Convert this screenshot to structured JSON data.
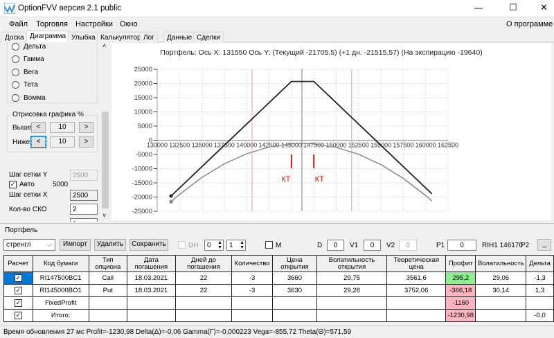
{
  "window": {
    "title": "OptionFVV версия 2.1 public",
    "minimize": "—",
    "maximize": "☐",
    "close": "✕"
  },
  "menu": {
    "items": [
      "Файл",
      "Торговля",
      "Настройки",
      "Окно"
    ],
    "about": "О программе"
  },
  "tabs": [
    "Доска",
    "Диаграмма",
    "Улыбка",
    "Калькулятор",
    "Лог",
    "Данные",
    "Сделки"
  ],
  "left": {
    "radios": [
      "Дельта",
      "Гамма",
      "Вега",
      "Тета",
      "Вомма"
    ],
    "draw_group": "Отрисовка графика %",
    "above_label": "Выше",
    "above_value": "10",
    "below_label": "Ниже",
    "below_value": "10",
    "prev": "<",
    "next": ">",
    "grid_y_label": "Шаг сетки Y",
    "grid_y_value": "2500",
    "auto_label": "Авто",
    "auto_value": "5000",
    "grid_x_label": "Шаг сетки X",
    "grid_x_value": "2500",
    "sko_label": "Кол-во СКО",
    "sko_value": "2",
    "next_value": "1"
  },
  "chart_data": {
    "type": "line",
    "title": "Портфель: Ось X:  131550 Ось Y:  (Текущий  -21705,5)  (+1 дн.  -21515,57)  (На экспирацию  -19640)",
    "xlim": [
      130000,
      162500
    ],
    "ylim": [
      -25000,
      25000
    ],
    "xticks": [
      130000,
      132500,
      135000,
      137500,
      140000,
      142500,
      145000,
      147500,
      150000,
      152500,
      155000,
      157500,
      160000,
      162500
    ],
    "yticks": [
      25000,
      20000,
      15000,
      10000,
      5000,
      0,
      -5000,
      -10000,
      -15000,
      -20000,
      -25000
    ],
    "grid": true,
    "x": [
      131550,
      132500,
      135000,
      137500,
      140000,
      142500,
      145000,
      146170,
      147500,
      150000,
      152500,
      155000,
      157500,
      160000,
      160700
    ],
    "series": [
      {
        "name": "На экспирацию",
        "color": "#222222",
        "values": [
          -19640,
          -16790,
          -9290,
          -1790,
          5710,
          13210,
          20710,
          20710,
          20710,
          13210,
          5710,
          -1790,
          -9290,
          -16790,
          -18890
        ]
      },
      {
        "name": "+1 дн.",
        "color": "#aaaaaa",
        "values": [
          -21516,
          -18950,
          -12990,
          -8240,
          -4700,
          -2350,
          -1200,
          -1080,
          -1240,
          -2470,
          -4890,
          -8510,
          -13330,
          -19360,
          -21270
        ]
      },
      {
        "name": "Текущий",
        "color": "#888888",
        "values": [
          -21705,
          -19114,
          -13128,
          -8346,
          -4770,
          -2398,
          -1232,
          -1100,
          -1271,
          -2514,
          -4963,
          -8616,
          -13475,
          -19539,
          -21452
        ]
      }
    ],
    "sigma_lines": [
      140600,
      151730
    ],
    "current_price": 146170,
    "markers": [
      {
        "x": 145000,
        "label": "КТ"
      },
      {
        "x": 147500,
        "label": "КТ"
      }
    ],
    "marker_range": [
      -5000,
      -9800
    ]
  },
  "portfolio": {
    "group": "Портфель",
    "select": "стренгл",
    "import": "Импорт",
    "delete": "Удалить",
    "save": "Сохранить",
    "dh": "DH",
    "spin1": "0",
    "spin2": "1",
    "m": "M",
    "d_label": "D",
    "d_value": "0",
    "v1_label": "V1",
    "v1_value": "0",
    "v2_label": "V2",
    "v2_value": "0",
    "p1_label": "P1",
    "p1_value": "0",
    "instrument": "RIH1 146170",
    "p2_label": "P2",
    "p2_value": "_"
  },
  "table": {
    "headers": [
      "Расчет",
      "Код бумаги",
      "Тип опциона",
      "Дата погашения",
      "Дней до погашения",
      "Количество",
      "Цена открытия",
      "Волатильность открытия",
      "Теоретическая цена",
      "Профит",
      "Волатильность",
      "Дельта"
    ],
    "rows": [
      [
        "",
        "RI147500BC1",
        "Call",
        "18.03.2021",
        "22",
        "-3",
        "3660",
        "29,75",
        "3561,6",
        "295,2",
        "29,06",
        "-1,3"
      ],
      [
        "",
        "RI145000BO1",
        "Put",
        "18.03.2021",
        "22",
        "-3",
        "3630",
        "29,28",
        "3752,06",
        "-366,18",
        "30,14",
        "1,3"
      ],
      [
        "",
        "FixedProfit",
        "",
        "",
        "",
        "",
        "",
        "",
        "",
        "-1160",
        "",
        ""
      ],
      [
        "",
        "Итого:",
        "",
        "",
        "",
        "",
        "",
        "",
        "",
        "-1230,98",
        "",
        "-0,0"
      ]
    ]
  },
  "status": "Время обновления 27 мс   Profit=-1230,98 Delta(Δ)=-0,06 Gamma(Γ)=-0,000223 Vega=-855,72 Theta(Θ)=571,59"
}
